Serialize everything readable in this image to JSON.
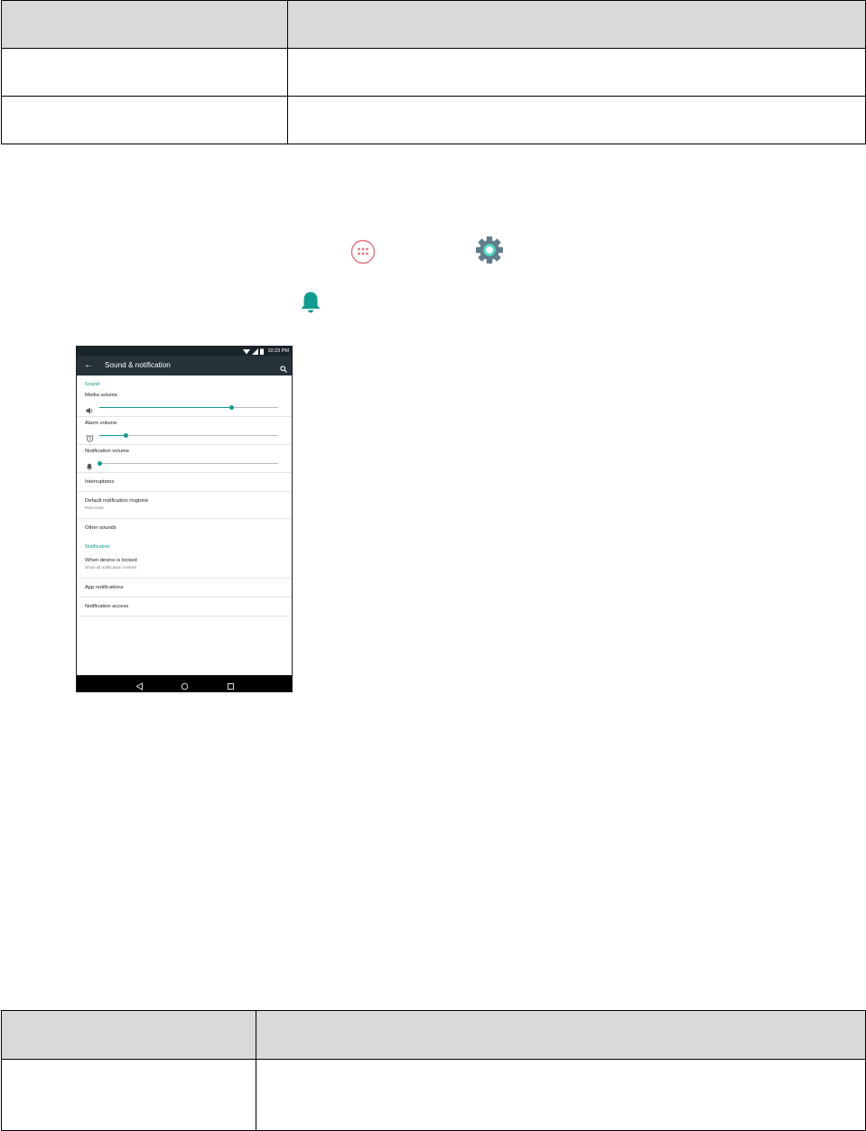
{
  "phone": {
    "status_time": "10:23 PM",
    "app_bar": {
      "title": "Sound & notification"
    },
    "sections": {
      "sound": "Sound",
      "notification": "Notification"
    },
    "volume": {
      "media": {
        "label": "Media volume",
        "level": 0.74
      },
      "alarm": {
        "label": "Alarm volume",
        "level": 0.15
      },
      "notification": {
        "label": "Notification volume",
        "level": 0.0
      }
    },
    "items": {
      "interruptions": "Interruptions",
      "ringtone": {
        "title": "Default notification ringtone",
        "subtitle": "Pixie Dust"
      },
      "other_sounds": "Other sounds",
      "locked": {
        "title": "When device is locked",
        "subtitle": "Show all notification content"
      },
      "app_notifications": "App notifications",
      "notification_access": "Notification access"
    },
    "colors": {
      "accent": "#0e9c8f",
      "app_bar": "#263238",
      "status_bar": "#1a252b"
    }
  },
  "icons": [
    "apps-icon",
    "settings-icon",
    "bell-icon"
  ],
  "icon_colors": {
    "apps": "#e8707c",
    "settings": "#607d8b",
    "bell": "#0e9c8f"
  }
}
